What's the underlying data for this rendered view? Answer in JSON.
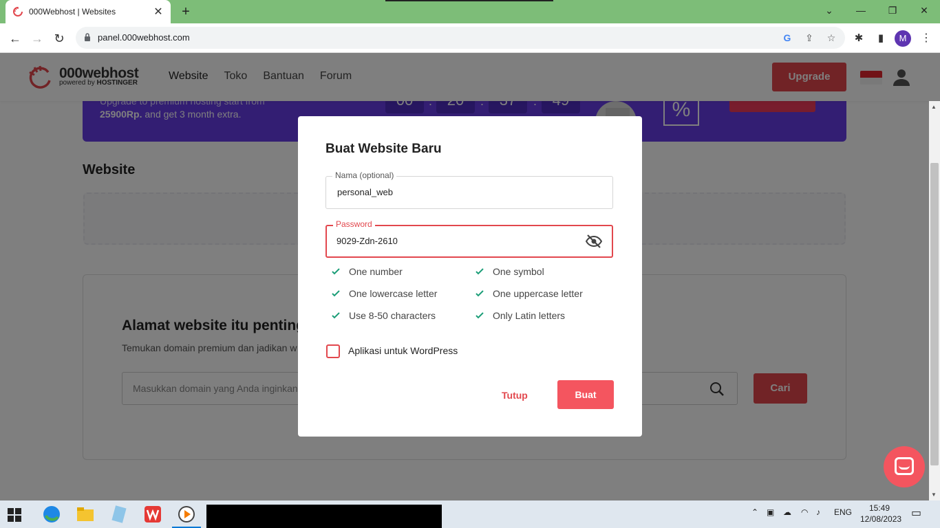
{
  "browser": {
    "tab_title": "000Webhost | Websites",
    "url": "panel.000webhost.com",
    "profile_initial": "M"
  },
  "site": {
    "logo_name": "000webhost",
    "logo_sub_prefix": "powered by",
    "logo_sub_brand": "HOSTINGER",
    "nav": [
      "Website",
      "Toko",
      "Bantuan",
      "Forum"
    ],
    "upgrade_label": "Upgrade"
  },
  "banner": {
    "line1": "Upgrade to premium hosting start from",
    "price": "25900Rp.",
    "line2_rest": " and get 3 month extra.",
    "timer": [
      "00",
      "20",
      "37",
      "49"
    ],
    "percent_symbol": "%"
  },
  "websites": {
    "section_title": "Website",
    "domain_heading": "Alamat website itu penting",
    "domain_sub": "Temukan domain premium dan jadikan w",
    "search_placeholder": "Masukkan domain yang Anda inginkan",
    "search_button": "Cari"
  },
  "modal": {
    "title": "Buat Website Baru",
    "name_label": "Nama (optional)",
    "name_value": "personal_web",
    "password_label": "Password",
    "password_value": "9029-Zdn-2610",
    "rules": [
      {
        "text": "One number"
      },
      {
        "text": "One symbol"
      },
      {
        "text": "One lowercase letter"
      },
      {
        "text": "One uppercase letter"
      },
      {
        "text": "Use 8-50 characters"
      },
      {
        "text": "Only Latin letters"
      }
    ],
    "wordpress_label": "Aplikasi untuk WordPress",
    "close_label": "Tutup",
    "create_label": "Buat"
  },
  "taskbar": {
    "language": "ENG",
    "time": "15:49",
    "date": "12/08/2023"
  },
  "colors": {
    "brand_red": "#e2474d",
    "banner_purple": "#673de6",
    "check_green": "#1b9e77",
    "chrome_green": "#7dbd78"
  }
}
